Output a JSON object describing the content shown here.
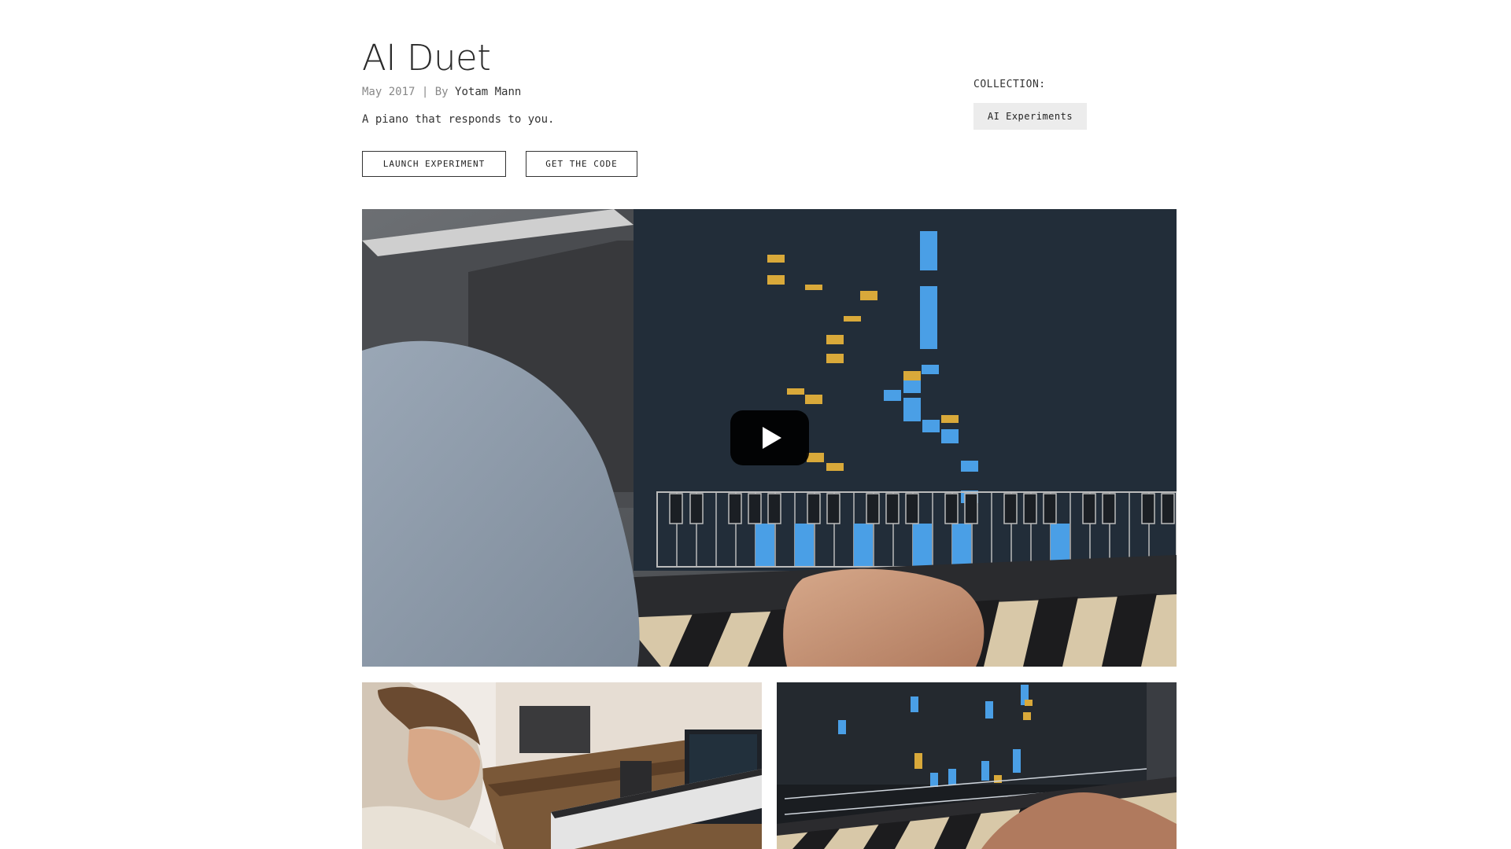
{
  "page": {
    "title": "AI Duet",
    "date": "May 2017",
    "separator": "|",
    "by_label": "By",
    "author": "Yotam Mann",
    "description": "A piano that responds to you."
  },
  "actions": {
    "launch_label": "LAUNCH EXPERIMENT",
    "code_label": "GET THE CODE"
  },
  "collection": {
    "label": "COLLECTION:",
    "tag": "AI Experiments"
  },
  "video": {
    "play_icon": "play-icon",
    "colors": {
      "user_notes": "#4a9fe6",
      "ai_notes": "#d9a93a",
      "screen": "#1f2a36"
    }
  }
}
